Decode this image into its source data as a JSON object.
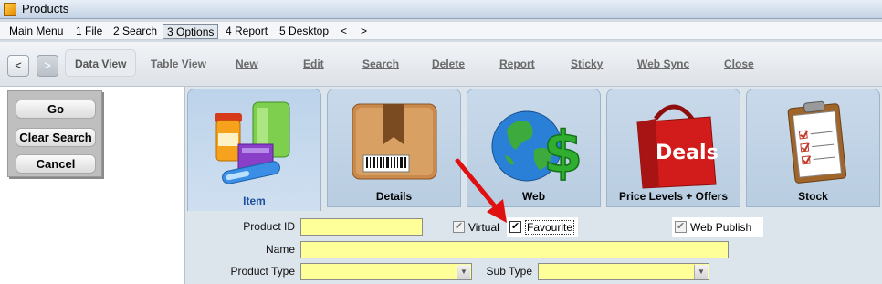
{
  "window": {
    "title": "Products"
  },
  "menu": {
    "items": [
      "Main Menu",
      "1 File",
      "2 Search",
      "3 Options",
      "4 Report",
      "5 Desktop",
      "<",
      ">"
    ],
    "selected": "3 Options"
  },
  "toolbar": {
    "back": "<",
    "forward": ">",
    "data_view": "Data View",
    "table_view": "Table View",
    "new": "New",
    "edit": "Edit",
    "search": "Search",
    "delete": "Delete",
    "report": "Report",
    "sticky": "Sticky",
    "web_sync": "Web Sync",
    "close": "Close"
  },
  "left_buttons": {
    "go": "Go",
    "clear_search": "Clear Search",
    "cancel": "Cancel"
  },
  "tabs": [
    {
      "label": "Item",
      "icon": "products-icon",
      "active": true
    },
    {
      "label": "Details",
      "icon": "box-barcode-icon",
      "active": false
    },
    {
      "label": "Web",
      "icon": "globe-dollar-icon",
      "active": false
    },
    {
      "label": "Price Levels + Offers",
      "icon": "deals-bag-icon",
      "active": false
    },
    {
      "label": "Stock",
      "icon": "inventory-clipboard-icon",
      "active": false
    }
  ],
  "form": {
    "product_id_label": "Product ID",
    "product_id_value": "",
    "virtual_label": "Virtual",
    "virtual_checked": true,
    "favourite_label": "Favourite",
    "favourite_checked": true,
    "web_publish_label": "Web Publish",
    "web_publish_checked": true,
    "name_label": "Name",
    "name_value": "",
    "product_type_label": "Product Type",
    "product_type_value": "",
    "sub_type_label": "Sub Type",
    "sub_type_value": ""
  },
  "colors": {
    "field_bg": "#ffff99",
    "active_tab_text": "#1c4f9c",
    "arrow": "#e01010"
  }
}
